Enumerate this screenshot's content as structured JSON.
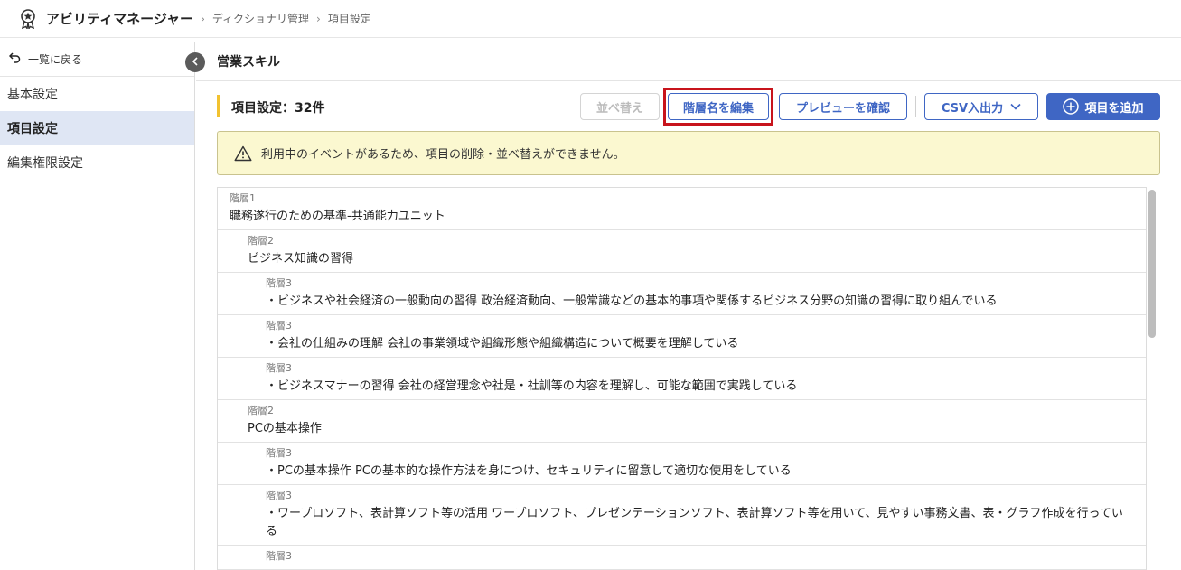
{
  "header": {
    "app_title": "アビリティマネージャー",
    "breadcrumbs": [
      "ディクショナリ管理",
      "項目設定"
    ]
  },
  "sidebar": {
    "back_label": "一覧に戻る",
    "items": [
      {
        "label": "基本設定"
      },
      {
        "label": "項目設定"
      },
      {
        "label": "編集権限設定"
      }
    ]
  },
  "main": {
    "page_title": "営業スキル",
    "section_label": "項目設定：32件",
    "buttons": {
      "sort": "並べ替え",
      "rename_levels": "階層名を編集",
      "preview": "プレビューを確認",
      "csv": "CSV入出力",
      "add": "項目を追加"
    },
    "notice": "利用中のイベントがあるため、項目の削除・並べ替えができません。",
    "rows": [
      {
        "level": "階層1",
        "text": "職務遂行のための基準-共通能力ユニット"
      },
      {
        "level": "階層2",
        "text": "ビジネス知識の習得"
      },
      {
        "level": "階層3",
        "text": "・ビジネスや社会経済の一般動向の習得 政治経済動向、一般常識などの基本的事項や関係するビジネス分野の知識の習得に取り組んでいる"
      },
      {
        "level": "階層3",
        "text": "・会社の仕組みの理解 会社の事業領域や組織形態や組織構造について概要を理解している"
      },
      {
        "level": "階層3",
        "text": "・ビジネスマナーの習得 会社の経営理念や社是・社訓等の内容を理解し、可能な範囲で実践している"
      },
      {
        "level": "階層2",
        "text": "PCの基本操作"
      },
      {
        "level": "階層3",
        "text": "・PCの基本操作 PCの基本的な操作方法を身につけ、セキュリティに留意して適切な使用をしている"
      },
      {
        "level": "階層3",
        "text": "・ワープロソフト、表計算ソフト等の活用 ワープロソフト、プレゼンテーションソフト、表計算ソフト等を用いて、見やすい事務文書、表・グラフ作成を行っている"
      },
      {
        "level": "階層3",
        "text": ""
      }
    ]
  },
  "colors": {
    "primary": "#3f66c4",
    "highlight": "#c8141c",
    "notice_bg": "#fbf8d0",
    "section_marker": "#f2c230",
    "active_sidebar": "#dfe6f4"
  }
}
